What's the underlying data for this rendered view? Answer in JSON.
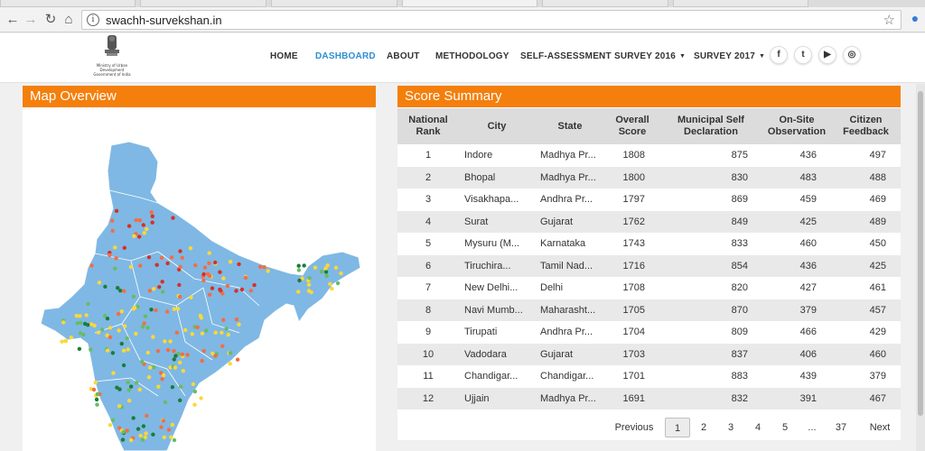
{
  "browser": {
    "url": "swachh-survekshan.in",
    "back_icon": "arrow-left",
    "forward_icon": "arrow-right",
    "reload_icon": "reload",
    "home_icon": "home",
    "bookmark_icon": "star"
  },
  "header": {
    "ministry_text": "Ministry of Urban Development Government of India",
    "nav": [
      {
        "label": "HOME",
        "active": false,
        "dropdown": false
      },
      {
        "label": "DASHBOARD",
        "active": true,
        "dropdown": false
      },
      {
        "label": "ABOUT",
        "active": false,
        "dropdown": false
      },
      {
        "label": "METHODOLOGY",
        "active": false,
        "dropdown": false
      },
      {
        "label": "SELF-ASSESSMENT",
        "active": false,
        "dropdown": false
      },
      {
        "label": "SURVEY 2016",
        "active": false,
        "dropdown": true
      },
      {
        "label": "SURVEY 2017",
        "active": false,
        "dropdown": true
      }
    ],
    "social": [
      {
        "name": "facebook-icon",
        "glyph": "f"
      },
      {
        "name": "twitter-icon",
        "glyph": "t"
      },
      {
        "name": "youtube-icon",
        "glyph": "▶"
      },
      {
        "name": "instagram-icon",
        "glyph": "◎"
      }
    ]
  },
  "map_panel": {
    "title": "Map Overview",
    "colors": {
      "land": "#7fb8e4",
      "high": "#d73027",
      "mid_high": "#f46d43",
      "mid": "#fdd835",
      "good": "#66bd63",
      "best": "#1a7d3a"
    }
  },
  "score_panel": {
    "title": "Score Summary",
    "columns": [
      "National Rank",
      "City",
      "State",
      "Overall Score",
      "Municipal Self Declaration",
      "On-Site Observation",
      "Citizen Feedback"
    ],
    "rows": [
      {
        "rank": "1",
        "city": "Indore",
        "state": "Madhya Pr...",
        "overall": "1808",
        "self": "875",
        "onsite": "436",
        "citizen": "497"
      },
      {
        "rank": "2",
        "city": "Bhopal",
        "state": "Madhya Pr...",
        "overall": "1800",
        "self": "830",
        "onsite": "483",
        "citizen": "488"
      },
      {
        "rank": "3",
        "city": "Visakhapa...",
        "state": "Andhra Pr...",
        "overall": "1797",
        "self": "869",
        "onsite": "459",
        "citizen": "469"
      },
      {
        "rank": "4",
        "city": "Surat",
        "state": "Gujarat",
        "overall": "1762",
        "self": "849",
        "onsite": "425",
        "citizen": "489"
      },
      {
        "rank": "5",
        "city": "Mysuru (M...",
        "state": "Karnataka",
        "overall": "1743",
        "self": "833",
        "onsite": "460",
        "citizen": "450"
      },
      {
        "rank": "6",
        "city": "Tiruchira...",
        "state": "Tamil Nad...",
        "overall": "1716",
        "self": "854",
        "onsite": "436",
        "citizen": "425"
      },
      {
        "rank": "7",
        "city": "New Delhi...",
        "state": "Delhi",
        "overall": "1708",
        "self": "820",
        "onsite": "427",
        "citizen": "461"
      },
      {
        "rank": "8",
        "city": "Navi Mumb...",
        "state": "Maharasht...",
        "overall": "1705",
        "self": "870",
        "onsite": "379",
        "citizen": "457"
      },
      {
        "rank": "9",
        "city": "Tirupati",
        "state": "Andhra Pr...",
        "overall": "1704",
        "self": "809",
        "onsite": "466",
        "citizen": "429"
      },
      {
        "rank": "10",
        "city": "Vadodara",
        "state": "Gujarat",
        "overall": "1703",
        "self": "837",
        "onsite": "406",
        "citizen": "460"
      },
      {
        "rank": "11",
        "city": "Chandigar...",
        "state": "Chandigar...",
        "overall": "1701",
        "self": "883",
        "onsite": "439",
        "citizen": "379"
      },
      {
        "rank": "12",
        "city": "Ujjain",
        "state": "Madhya Pr...",
        "overall": "1691",
        "self": "832",
        "onsite": "391",
        "citizen": "467"
      }
    ],
    "pagination": {
      "previous": "Previous",
      "pages": [
        "1",
        "2",
        "3",
        "4",
        "5",
        "...",
        "37"
      ],
      "current": "1",
      "next": "Next"
    }
  }
}
